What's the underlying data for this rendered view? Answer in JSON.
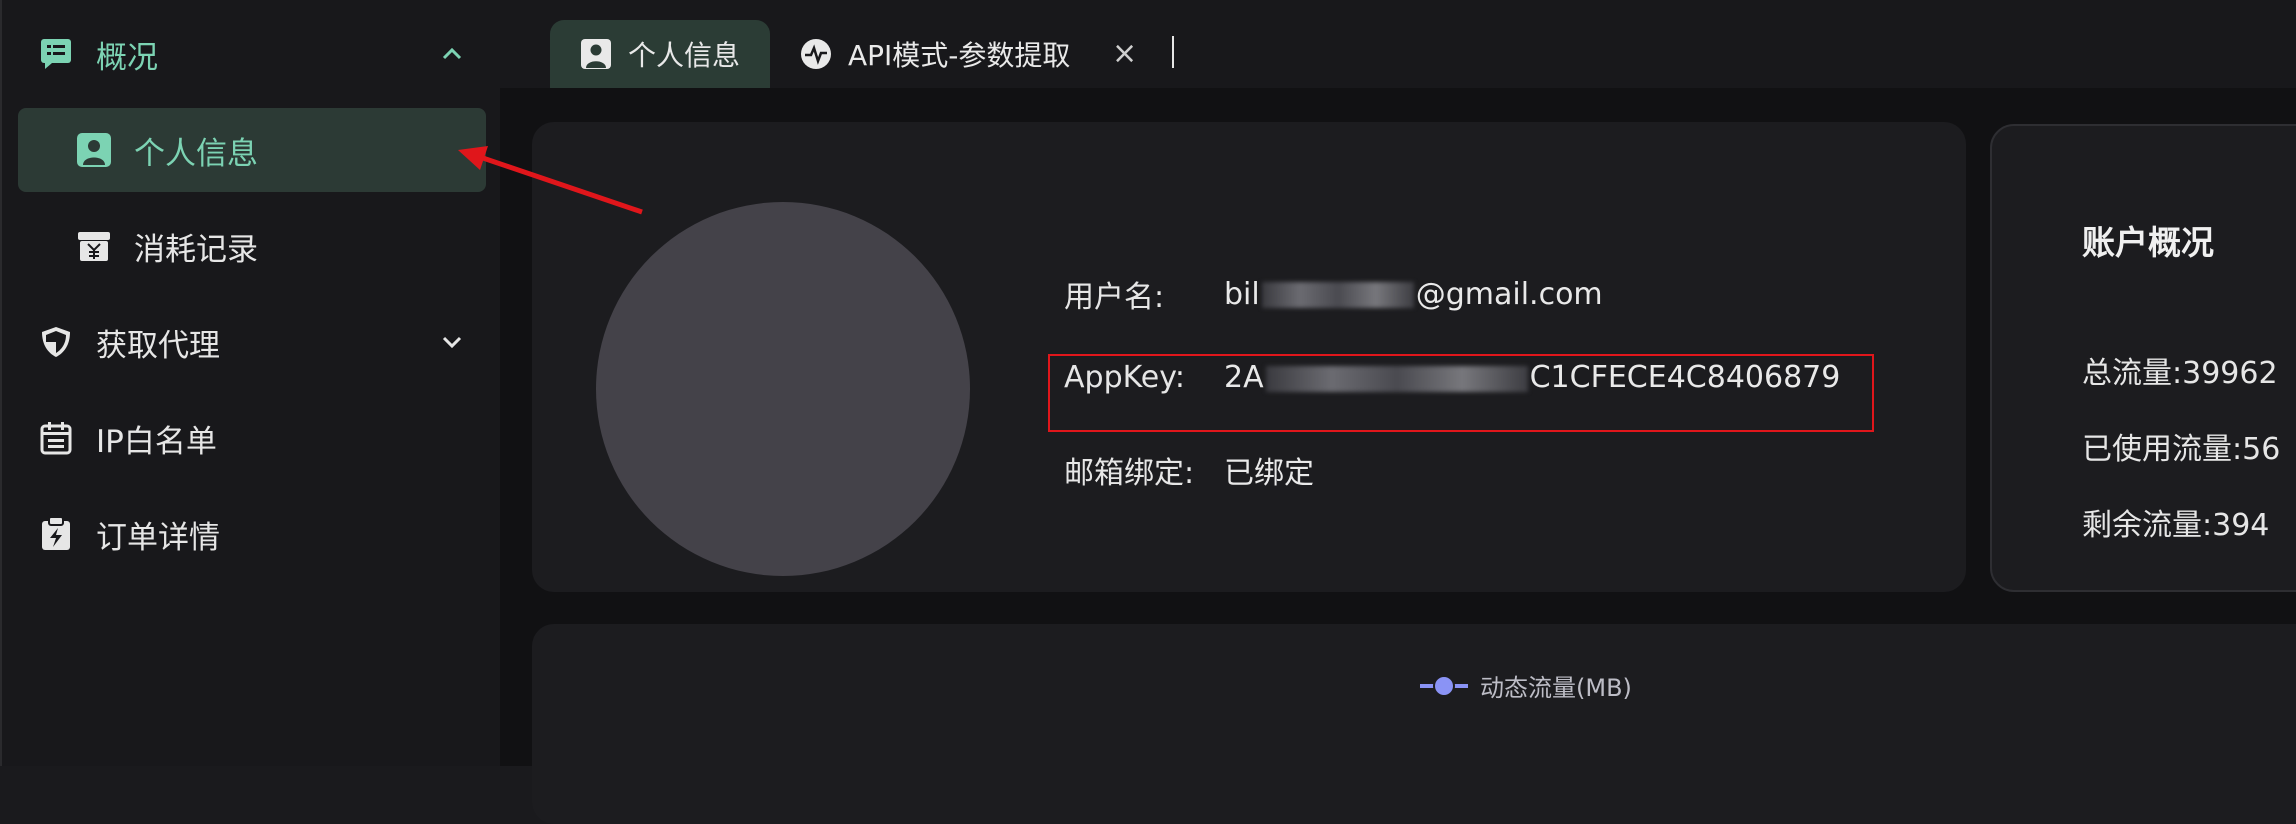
{
  "sidebar": {
    "items": [
      {
        "label": "概况",
        "icon": "chat-list-icon"
      },
      {
        "label": "个人信息",
        "icon": "user-badge-icon"
      },
      {
        "label": "消耗记录",
        "icon": "yen-box-icon"
      },
      {
        "label": "获取代理",
        "icon": "shield-icon"
      },
      {
        "label": "IP白名单",
        "icon": "calendar-list-icon"
      },
      {
        "label": "订单详情",
        "icon": "clipboard-bolt-icon"
      }
    ]
  },
  "tabs": [
    {
      "label": "个人信息",
      "icon": "user-badge-icon",
      "active": true
    },
    {
      "label": "API模式-参数提取",
      "icon": "pulse-icon",
      "active": false
    }
  ],
  "tab_close_glyph": "×",
  "profile": {
    "username_label": "用户名:",
    "username_prefix": "bil",
    "username_suffix": "@gmail.com",
    "appkey_label": "AppKey:",
    "appkey_prefix": "2A",
    "appkey_suffix": "C1CFECE4C8406879",
    "email_label": "邮箱绑定:",
    "email_status": "已绑定"
  },
  "account": {
    "title": "账户概况",
    "total_label": "总流量:",
    "total_value": "39962",
    "used_label": "已使用流量:",
    "used_value": "56",
    "remaining_label": "剩余流量:",
    "remaining_value": "394"
  },
  "chart": {
    "legend": "动态流量(MB)"
  },
  "colors": {
    "accent": "#7cd3b3",
    "bound": "#4cd964",
    "annotation": "#e0161b",
    "legend": "#8a93f5"
  }
}
